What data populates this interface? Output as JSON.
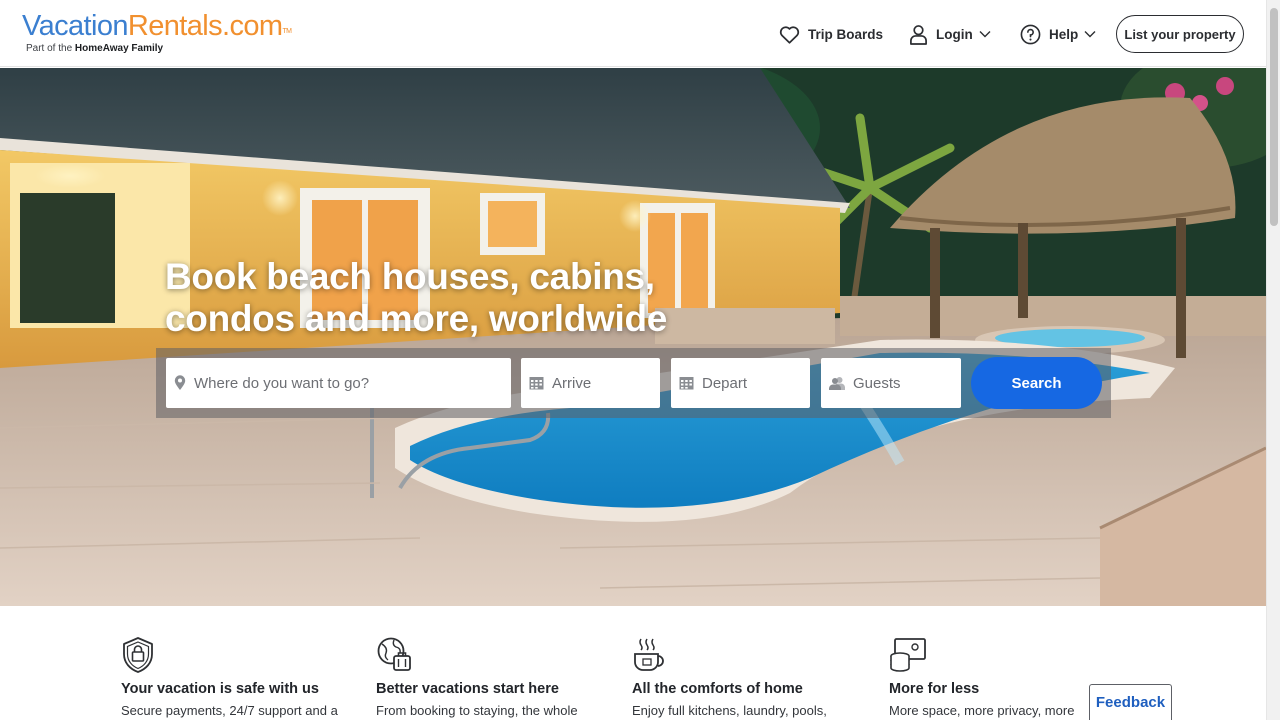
{
  "brand": {
    "logo_part1": "Vacation",
    "logo_part2": "Rentals.com",
    "logo_tm": "TM",
    "tagline_prefix": "Part of the ",
    "tagline_bold": "HomeAway Family",
    "colors": {
      "blue": "#3b7fd0",
      "orange": "#f1902f"
    }
  },
  "nav": {
    "trip_boards": "Trip Boards",
    "login": "Login",
    "help": "Help",
    "list_property": "List your property",
    "icons": {
      "trip_boards": "heart-icon",
      "login": "user-icon",
      "help": "question-circle-icon",
      "dropdown": "chevron-down-icon"
    }
  },
  "hero": {
    "headline_line1": "Book beach houses, cabins,",
    "headline_line2": "condos and more, worldwide"
  },
  "search": {
    "where_placeholder": "Where do you want to go?",
    "arrive_placeholder": "Arrive",
    "depart_placeholder": "Depart",
    "guests_placeholder": "Guests",
    "button_label": "Search",
    "button_color": "#1668e3",
    "icons": {
      "where": "map-pin-icon",
      "arrive": "calendar-icon",
      "depart": "calendar-icon",
      "guests": "guests-icon"
    }
  },
  "features": [
    {
      "title": "Your vacation is safe with us",
      "text": "Secure payments, 24/7 support and a",
      "icon": "shield-lock-icon"
    },
    {
      "title": "Better vacations start here",
      "text": "From booking to staying, the whole",
      "icon": "globe-luggage-icon"
    },
    {
      "title": "All the comforts of home",
      "text": "Enjoy full kitchens, laundry, pools,",
      "icon": "coffee-cup-icon"
    },
    {
      "title": "More for less",
      "text": "More space, more privacy, more",
      "icon": "money-icon"
    }
  ],
  "feedback": {
    "label": "Feedback"
  }
}
